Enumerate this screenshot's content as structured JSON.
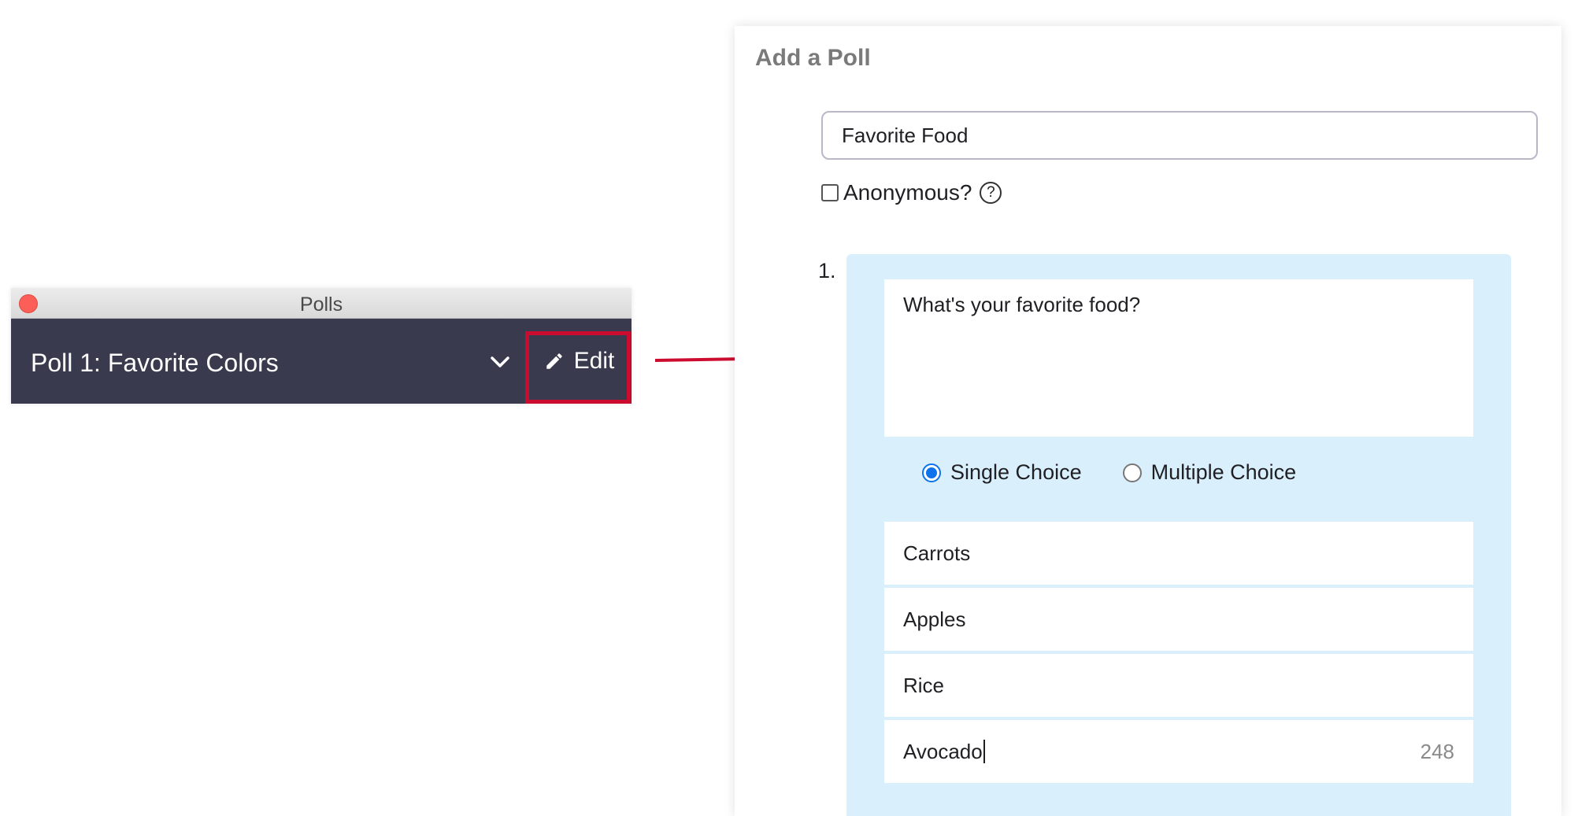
{
  "polls_window": {
    "title": "Polls",
    "poll_name": "Poll 1: Favorite Colors",
    "edit_label": "Edit"
  },
  "add_poll": {
    "heading": "Add a Poll",
    "poll_title": "Favorite Food",
    "anonymous_label": "Anonymous?",
    "help_glyph": "?",
    "anonymous_checked": false,
    "question_number": "1.",
    "question_text": "What's your favorite food?",
    "choice_types": [
      {
        "label": "Single Choice",
        "selected": true
      },
      {
        "label": "Multiple Choice",
        "selected": false
      }
    ],
    "answers": [
      "Carrots",
      "Apples",
      "Rice",
      "Avocado"
    ],
    "remaining_chars": "248"
  },
  "colors": {
    "accent": "#0e72ed",
    "highlight_box": "#cc0c2f",
    "dark_bar": "#3a3a4e",
    "question_bg": "#d9effc"
  },
  "icons": [
    "close-icon",
    "chevron-down-icon",
    "pencil-icon",
    "help-icon",
    "arrow-right-icon"
  ]
}
